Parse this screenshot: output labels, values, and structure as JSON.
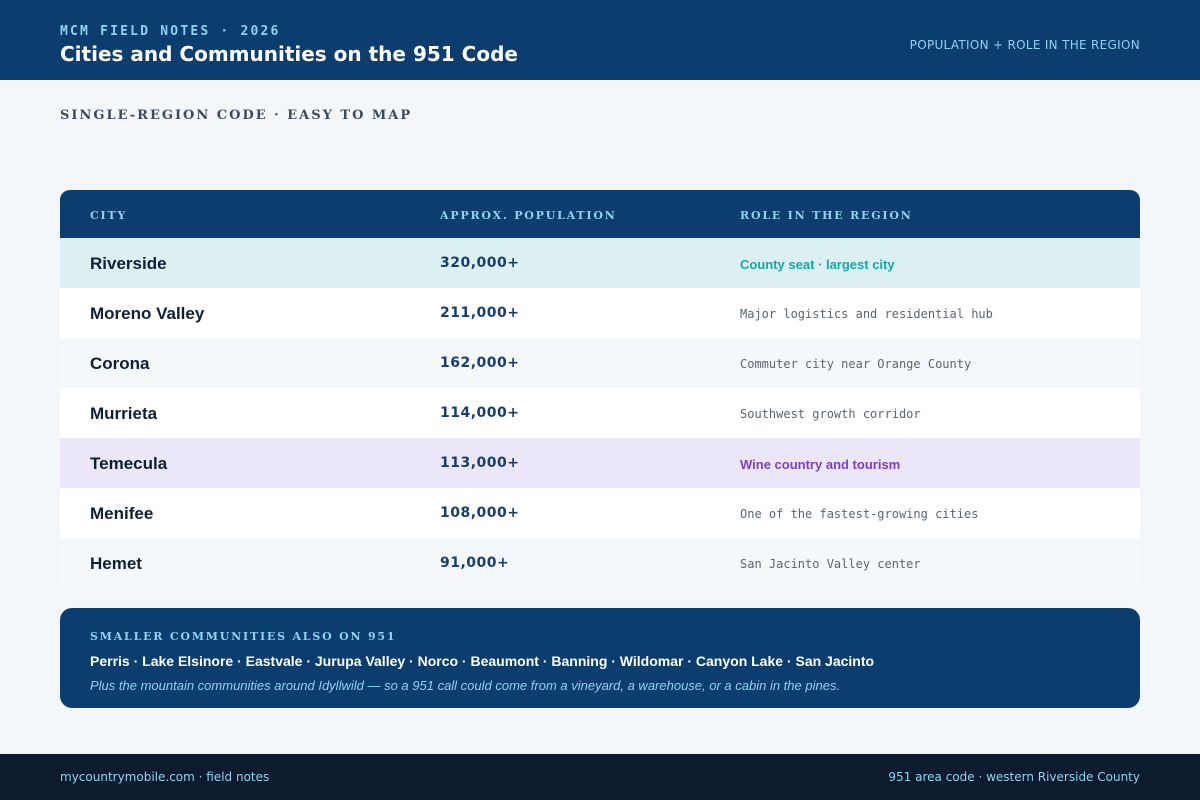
{
  "header": {
    "eyebrow": "MCM FIELD NOTES · 2026",
    "title": "Cities and Communities on the 951 Code",
    "right_label": "POPULATION + ROLE IN THE REGION"
  },
  "subheading": "SINGLE-REGION CODE · EASY TO MAP",
  "table": {
    "columns": [
      "CITY",
      "APPROX. POPULATION",
      "ROLE IN THE REGION"
    ],
    "rows": [
      {
        "city": "Riverside",
        "population": "320,000+",
        "role": "County seat · largest city"
      },
      {
        "city": "Moreno Valley",
        "population": "211,000+",
        "role": "Major logistics and residential hub"
      },
      {
        "city": "Corona",
        "population": "162,000+",
        "role": "Commuter city near Orange County"
      },
      {
        "city": "Murrieta",
        "population": "114,000+",
        "role": "Southwest growth corridor"
      },
      {
        "city": "Temecula",
        "population": "113,000+",
        "role": "Wine country and tourism"
      },
      {
        "city": "Menifee",
        "population": "108,000+",
        "role": "One of the fastest-growing cities"
      },
      {
        "city": "Hemet",
        "population": "91,000+",
        "role": "San Jacinto Valley center"
      }
    ]
  },
  "callout": {
    "label": "SMALLER COMMUNITIES ALSO ON 951",
    "list": "Perris · Lake Elsinore · Eastvale · Jurupa Valley · Norco · Beaumont · Banning · Wildomar · Canyon Lake · San Jacinto",
    "note": "Plus the mountain communities around Idyllwild — so a 951 call could come from a vineyard, a warehouse, or a cabin in the pines."
  },
  "footer": {
    "left": "mycountrymobile.com · field notes",
    "right": "951 area code · western Riverside County"
  },
  "colors": {
    "navy": "#0b3d6e",
    "accent_cyan": "#8fd3ef",
    "teal_highlight": "#14a8a8",
    "purple_highlight": "#7b3fcf"
  }
}
